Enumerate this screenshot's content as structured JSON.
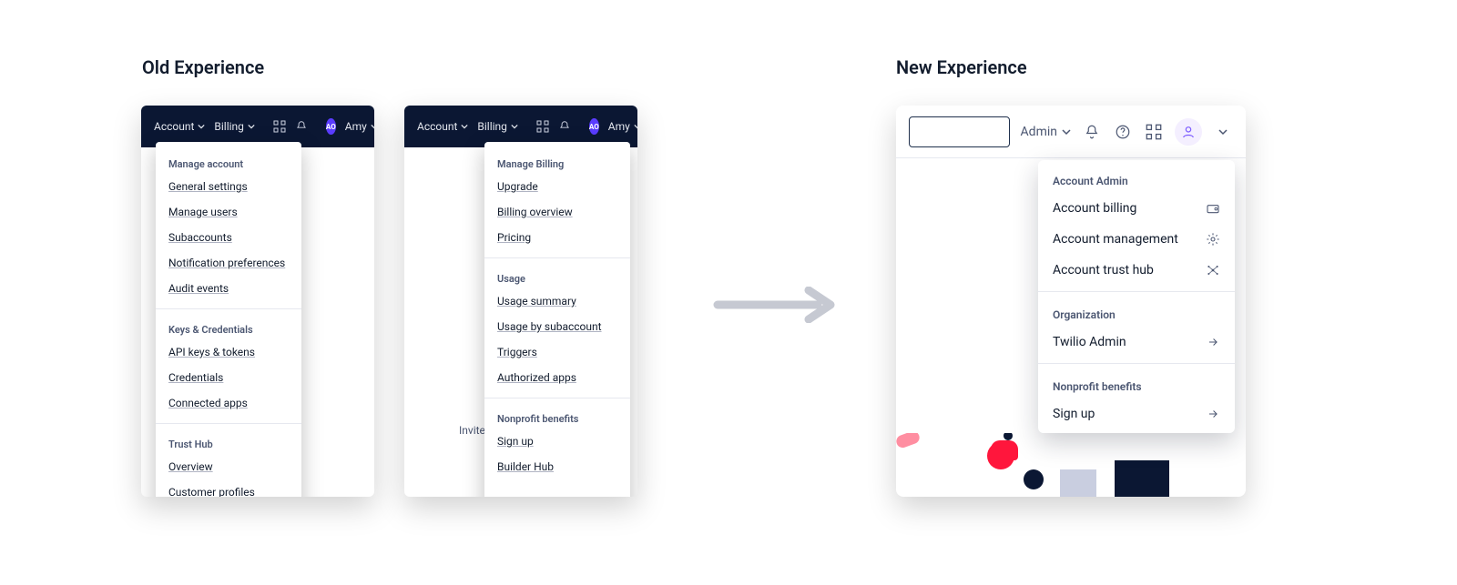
{
  "titles": {
    "old": "Old Experience",
    "new": "New Experience"
  },
  "old": {
    "topbar": {
      "account": "Account",
      "billing": "Billing",
      "avatar_initials": "AO",
      "user": "Amy"
    },
    "bg_text": "Invite",
    "arrows_hint": "↑ ↓",
    "account_menu": {
      "s1_title": "Manage account",
      "s1_items": [
        "General settings",
        "Manage users",
        "Subaccounts",
        "Notification preferences",
        "Audit events"
      ],
      "s2_title": "Keys & Credentials",
      "s2_items": [
        "API keys & tokens",
        "Credentials",
        "Connected apps"
      ],
      "s3_title": "Trust Hub",
      "s3_items": [
        "Overview",
        "Customer profiles"
      ]
    },
    "billing_menu": {
      "s1_title": "Manage Billing",
      "s1_items": [
        "Upgrade",
        "Billing overview",
        "Pricing"
      ],
      "s2_title": "Usage",
      "s2_items": [
        "Usage summary",
        "Usage by subaccount",
        "Triggers",
        "Authorized apps"
      ],
      "s3_title": "Nonprofit benefits",
      "s3_items": [
        "Sign up",
        "Builder Hub"
      ]
    }
  },
  "new": {
    "topbar": {
      "admin": "Admin"
    },
    "menu": {
      "s1_title": "Account Admin",
      "s1_items": [
        "Account billing",
        "Account management",
        "Account trust hub"
      ],
      "s2_title": "Organization",
      "s2_items": [
        "Twilio Admin"
      ],
      "s3_title": "Nonprofit benefits",
      "s3_items": [
        "Sign up"
      ]
    }
  }
}
